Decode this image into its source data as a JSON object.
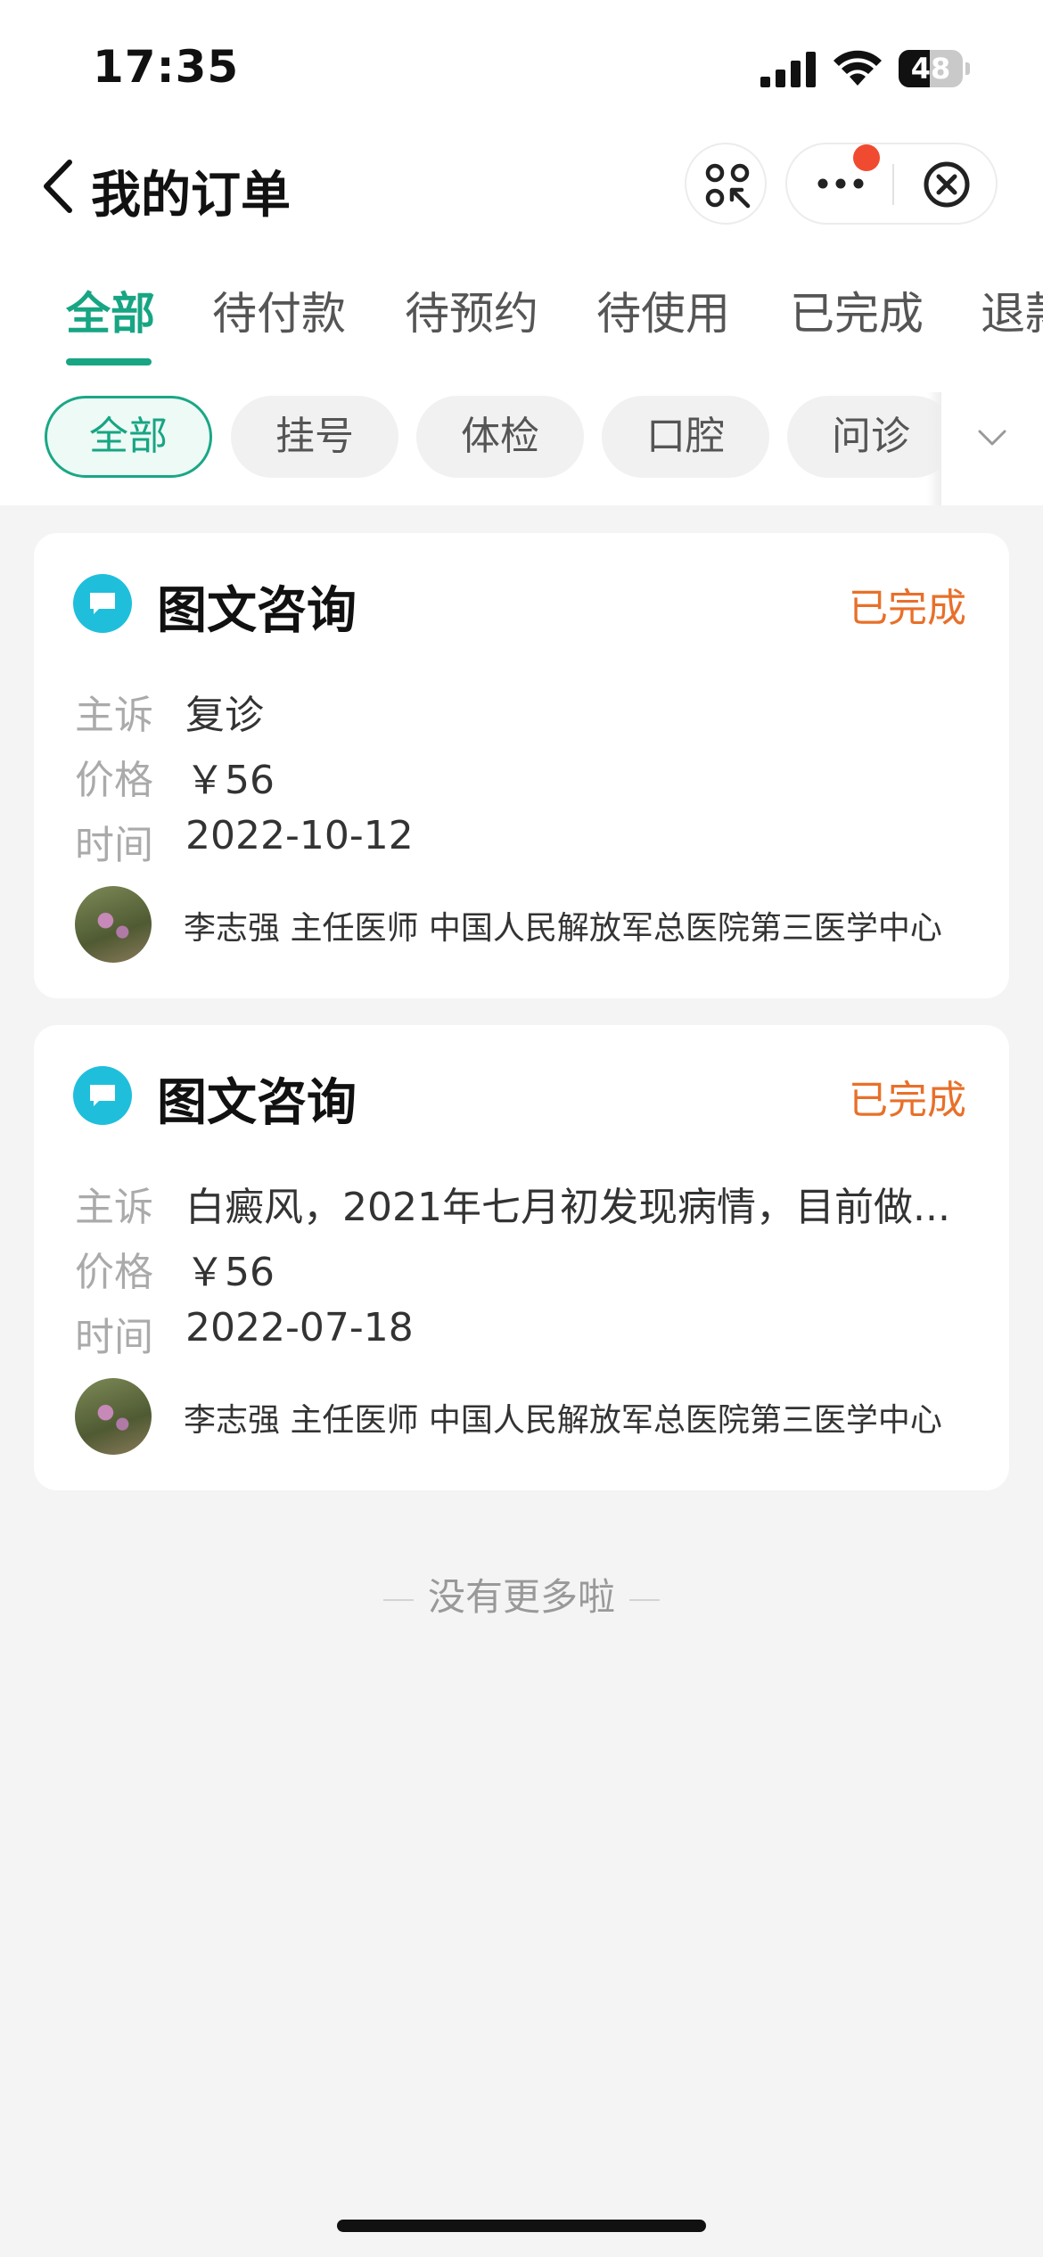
{
  "status_bar": {
    "time": "17:35",
    "battery_level": "48"
  },
  "nav": {
    "title": "我的订单"
  },
  "main_tabs": [
    {
      "label": "全部",
      "active": true
    },
    {
      "label": "待付款",
      "active": false
    },
    {
      "label": "待预约",
      "active": false
    },
    {
      "label": "待使用",
      "active": false
    },
    {
      "label": "已完成",
      "active": false
    },
    {
      "label": "退款",
      "active": false
    }
  ],
  "filter_chips": [
    {
      "label": "全部",
      "active": true
    },
    {
      "label": "挂号",
      "active": false
    },
    {
      "label": "体检",
      "active": false
    },
    {
      "label": "口腔",
      "active": false
    },
    {
      "label": "问诊",
      "active": false
    }
  ],
  "labels": {
    "complaint": "主诉",
    "price": "价格",
    "time": "时间"
  },
  "orders": [
    {
      "type": "图文咨询",
      "status": "已完成",
      "complaint": "复诊",
      "price": "￥56",
      "time": "2022-10-12",
      "doctor": "李志强 主任医师 中国人民解放军总医院第三医学中心"
    },
    {
      "type": "图文咨询",
      "status": "已完成",
      "complaint": "白癜风，2021年七月初发现病情，目前做...",
      "price": "￥56",
      "time": "2022-07-18",
      "doctor": "李志强 主任医师 中国人民解放军总医院第三医学中心"
    }
  ],
  "footer": {
    "no_more": "没有更多啦"
  },
  "colors": {
    "accent": "#17a583",
    "status_done": "#e8702a",
    "icon_bg": "#1fbfdc",
    "badge": "#f04b30"
  }
}
